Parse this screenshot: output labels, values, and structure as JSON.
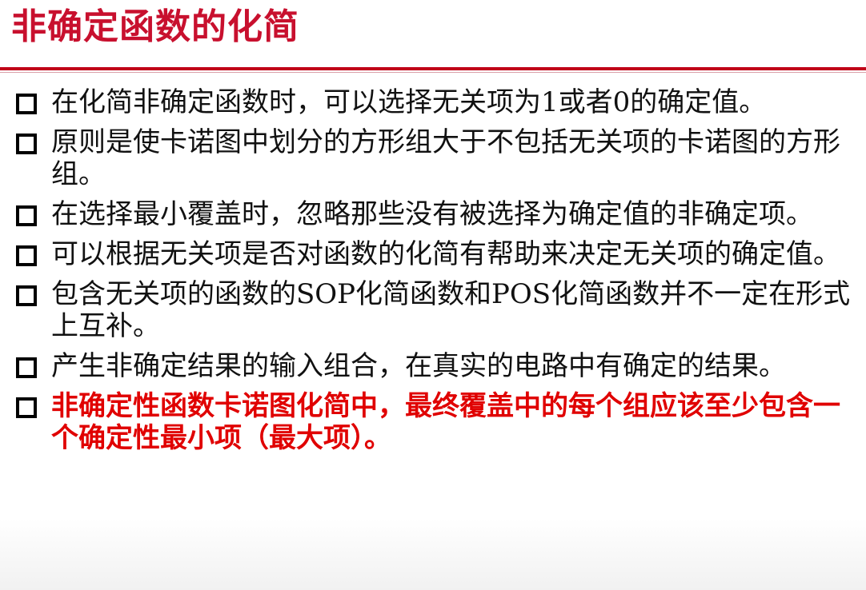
{
  "slide": {
    "title": "非确定函数的化简",
    "bullets": [
      {
        "text": "在化简非确定函数时，可以选择无关项为1或者0的确定值。",
        "highlight": false
      },
      {
        "text": "原则是使卡诺图中划分的方形组大于不包括无关项的卡诺图的方形组。",
        "highlight": false
      },
      {
        "text": "在选择最小覆盖时，忽略那些没有被选择为确定值的非确定项。",
        "highlight": false
      },
      {
        "text": "可以根据无关项是否对函数的化简有帮助来决定无关项的确定值。",
        "highlight": false
      },
      {
        "text": "包含无关项的函数的SOP化简函数和POS化简函数并不一定在形式上互补。",
        "highlight": false
      },
      {
        "text": "产生非确定结果的输入组合，在真实的电路中有确定的结果。",
        "highlight": false
      },
      {
        "text": "非确定性函数卡诺图化简中，最终覆盖中的每个组应该至少包含一个确定性最小项（最大项）。",
        "highlight": true
      }
    ]
  },
  "colors": {
    "title": "#c8102e",
    "rule": "#c00018",
    "body_text": "#111111",
    "highlight_text": "#e00000"
  },
  "icons": {
    "bullet": "hollow-square-bullet-icon"
  }
}
